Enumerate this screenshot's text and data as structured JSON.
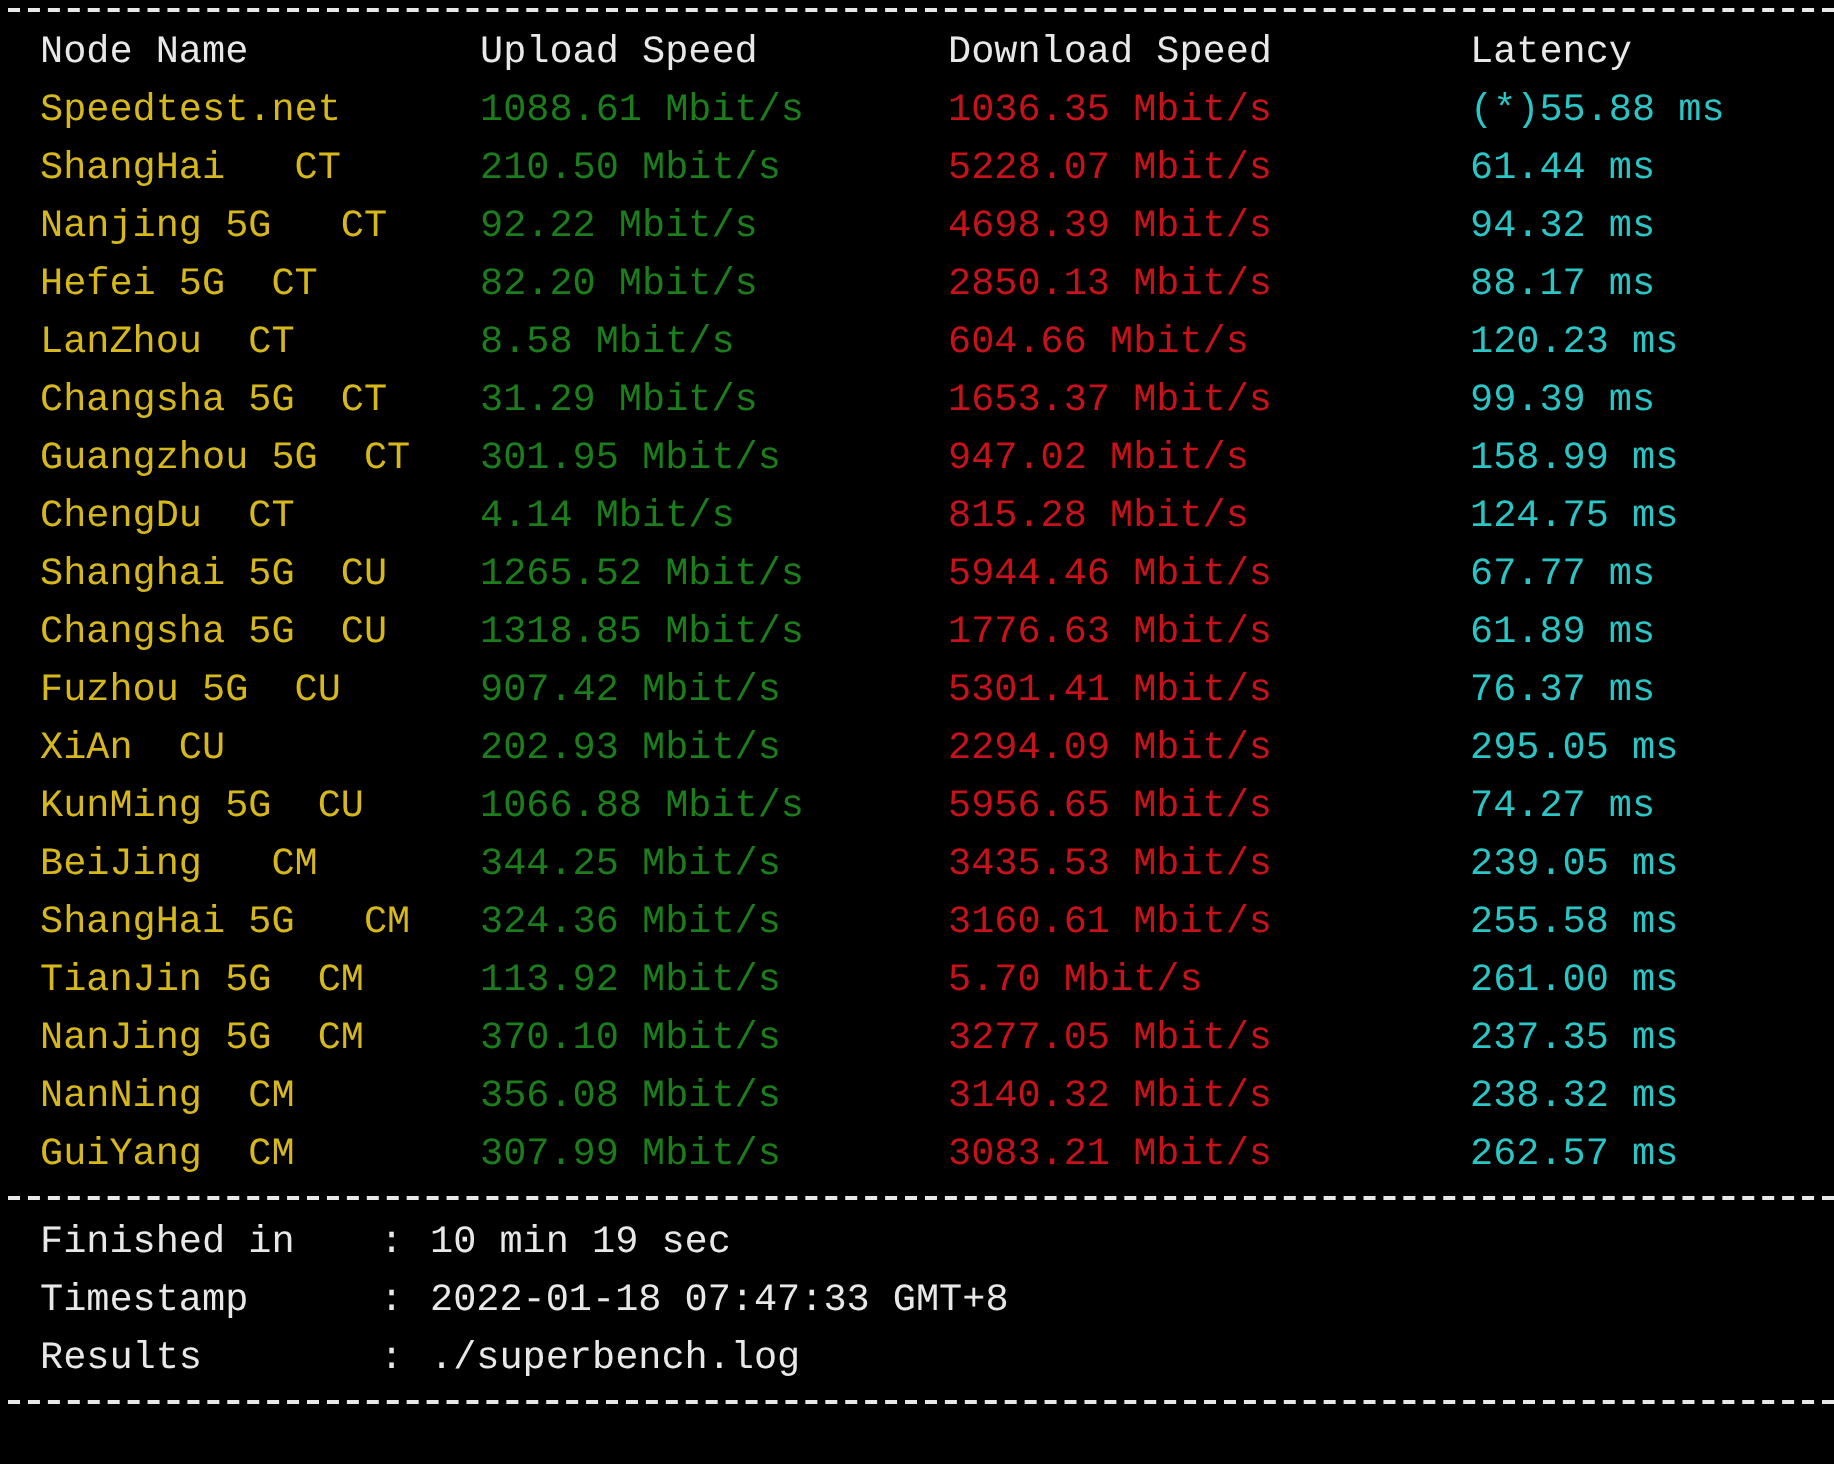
{
  "columns": [
    "Node Name",
    "Upload Speed",
    "Download Speed",
    "Latency"
  ],
  "rows": [
    {
      "node": "Speedtest.net",
      "upload": "1088.61 Mbit/s",
      "download": "1036.35 Mbit/s",
      "latency": "(*)55.88 ms"
    },
    {
      "node": "ShangHai   CT",
      "upload": "210.50 Mbit/s",
      "download": "5228.07 Mbit/s",
      "latency": "61.44 ms"
    },
    {
      "node": "Nanjing 5G   CT",
      "upload": "92.22 Mbit/s",
      "download": "4698.39 Mbit/s",
      "latency": "94.32 ms"
    },
    {
      "node": "Hefei 5G  CT",
      "upload": "82.20 Mbit/s",
      "download": "2850.13 Mbit/s",
      "latency": "88.17 ms"
    },
    {
      "node": "LanZhou  CT",
      "upload": "8.58 Mbit/s",
      "download": "604.66 Mbit/s",
      "latency": "120.23 ms"
    },
    {
      "node": "Changsha 5G  CT",
      "upload": "31.29 Mbit/s",
      "download": "1653.37 Mbit/s",
      "latency": "99.39 ms"
    },
    {
      "node": "Guangzhou 5G  CT",
      "upload": "301.95 Mbit/s",
      "download": "947.02 Mbit/s",
      "latency": "158.99 ms"
    },
    {
      "node": "ChengDu  CT",
      "upload": "4.14 Mbit/s",
      "download": "815.28 Mbit/s",
      "latency": "124.75 ms"
    },
    {
      "node": "Shanghai 5G  CU",
      "upload": "1265.52 Mbit/s",
      "download": "5944.46 Mbit/s",
      "latency": "67.77 ms"
    },
    {
      "node": "Changsha 5G  CU",
      "upload": "1318.85 Mbit/s",
      "download": "1776.63 Mbit/s",
      "latency": "61.89 ms"
    },
    {
      "node": "Fuzhou 5G  CU",
      "upload": "907.42 Mbit/s",
      "download": "5301.41 Mbit/s",
      "latency": "76.37 ms"
    },
    {
      "node": "XiAn  CU",
      "upload": "202.93 Mbit/s",
      "download": "2294.09 Mbit/s",
      "latency": "295.05 ms"
    },
    {
      "node": "KunMing 5G  CU",
      "upload": "1066.88 Mbit/s",
      "download": "5956.65 Mbit/s",
      "latency": "74.27 ms"
    },
    {
      "node": "BeiJing   CM",
      "upload": "344.25 Mbit/s",
      "download": "3435.53 Mbit/s",
      "latency": "239.05 ms"
    },
    {
      "node": "ShangHai 5G   CM",
      "upload": "324.36 Mbit/s",
      "download": "3160.61 Mbit/s",
      "latency": "255.58 ms"
    },
    {
      "node": "TianJin 5G  CM",
      "upload": "113.92 Mbit/s",
      "download": "5.70 Mbit/s",
      "latency": "261.00 ms"
    },
    {
      "node": "NanJing 5G  CM",
      "upload": "370.10 Mbit/s",
      "download": "3277.05 Mbit/s",
      "latency": "237.35 ms"
    },
    {
      "node": "NanNing  CM",
      "upload": "356.08 Mbit/s",
      "download": "3140.32 Mbit/s",
      "latency": "238.32 ms"
    },
    {
      "node": "GuiYang  CM",
      "upload": "307.99 Mbit/s",
      "download": "3083.21 Mbit/s",
      "latency": "262.57 ms"
    }
  ],
  "summary": [
    {
      "label": "Finished in",
      "separator": ":",
      "value": "10 min 19 sec"
    },
    {
      "label": "Timestamp",
      "separator": ":",
      "value": "2022-01-18 07:47:33 GMT+8"
    },
    {
      "label": "Results",
      "separator": ":",
      "value": "./superbench.log"
    }
  ]
}
